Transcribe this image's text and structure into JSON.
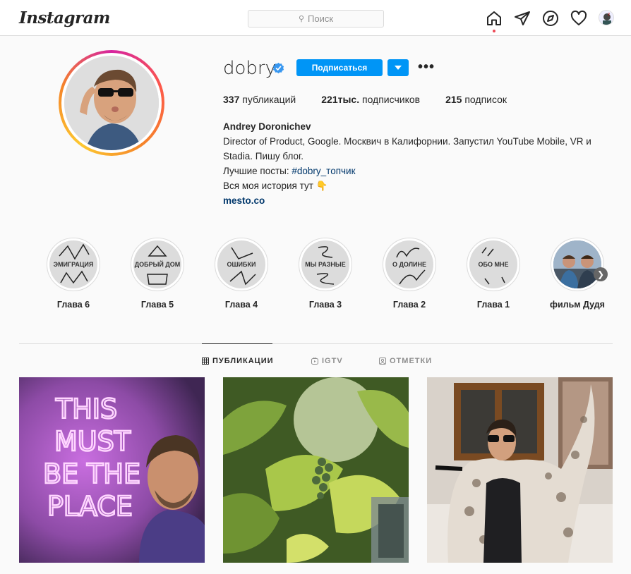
{
  "nav": {
    "logo": "Instagram",
    "search_placeholder": "Поиск",
    "icons": [
      "home-icon",
      "direct-icon",
      "explore-icon",
      "activity-heart-icon",
      "profile-avatar"
    ]
  },
  "profile": {
    "username": "dobry",
    "verified": true,
    "follow_label": "Подписаться",
    "stats": [
      {
        "count": "337",
        "label": "публикаций"
      },
      {
        "count": "221тыс.",
        "label": "подписчиков"
      },
      {
        "count": "215",
        "label": "подписок"
      }
    ],
    "bio": {
      "name": "Andrey Doronichev",
      "line1": "Director of Product, Google. Москвич в Калифорнии. Запустил YouTube Mobile, VR и",
      "line2": "Stadia. Пишу блог.",
      "line3_prefix": "Лучшие посты: ",
      "hashtag": "#dobry_топчик",
      "line4": "Вся моя история тут 👇",
      "link": "mesto.co"
    }
  },
  "highlights": [
    {
      "cover": "ЭМИГРАЦИЯ",
      "label": "Глава 6"
    },
    {
      "cover": "ДОБРЫЙ ДОМ",
      "label": "Глава 5"
    },
    {
      "cover": "ОШИБКИ",
      "label": "Глава 4"
    },
    {
      "cover": "МЫ РАЗНЫЕ",
      "label": "Глава 3"
    },
    {
      "cover": "О ДОЛИНЕ",
      "label": "Глава 2"
    },
    {
      "cover": "ОБО МНЕ",
      "label": "Глава 1"
    },
    {
      "cover": "",
      "label": "фильм Дудя"
    }
  ],
  "tabs": [
    {
      "label": "ПУБЛИКАЦИИ",
      "icon": "grid-icon",
      "active": true
    },
    {
      "label": "IGTV",
      "icon": "igtv-icon",
      "active": false
    },
    {
      "label": "ОТМЕТКИ",
      "icon": "tagged-icon",
      "active": false
    }
  ],
  "posts": [
    {
      "neon_text": [
        "THIS",
        "MUST",
        "BE THE",
        "PLACE"
      ]
    },
    {
      "subject": "grape-leaves-photo"
    },
    {
      "subject": "fur-coat-photo"
    }
  ],
  "colors": {
    "accent": "#0095f6",
    "link": "#00376b",
    "neon": "#ff7cff",
    "notification_dot": "#ed4956"
  }
}
